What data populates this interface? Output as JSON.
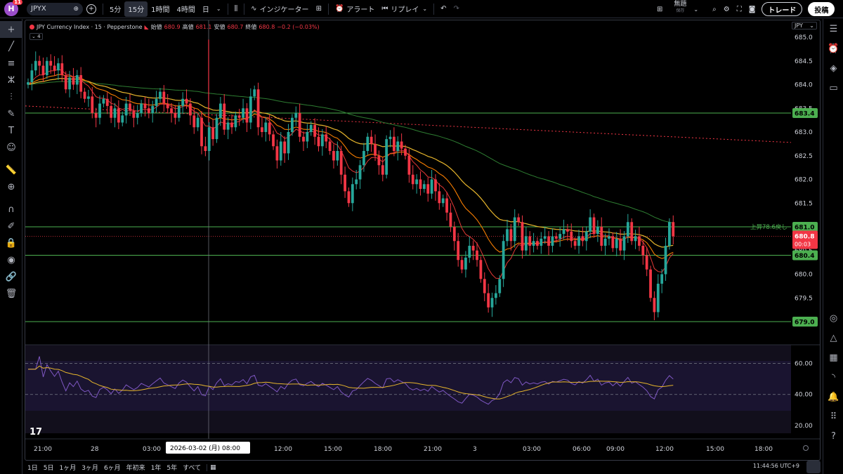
{
  "topbar": {
    "notification_count": "11",
    "logo_letter": "H",
    "symbol": "JPYX",
    "intervals": [
      "5分",
      "15分",
      "1時間",
      "4時間",
      "日"
    ],
    "selected_interval": "15分",
    "indicators_label": "インジケーター",
    "alert_label": "アラート",
    "replay_label": "リプレイ",
    "layout_name": "無題",
    "layout_sub": "保存",
    "trade_label": "トレード",
    "publish_label": "投稿"
  },
  "legend": {
    "title": "JPY Currency Index · 15 · Pepperstone",
    "open_label": "始値",
    "open": "680.9",
    "high_label": "高値",
    "high": "681.1",
    "low_label": "安値",
    "low": "680.7",
    "close_label": "終値",
    "close": "680.8",
    "change": "−0.2 (−0.03%)",
    "collapse": "4"
  },
  "currency_badge": "JPY",
  "price_axis": [
    "685.0",
    "684.5",
    "684.0",
    "683.5",
    "683.0",
    "682.5",
    "682.0",
    "681.5",
    "681.0",
    "680.5",
    "680.0",
    "679.5",
    "679.0"
  ],
  "price_levels": [
    {
      "label": "683.4",
      "value": 683.4
    },
    {
      "label": "681.0",
      "value": 681.0
    },
    {
      "label": "680.4",
      "value": 680.4
    },
    {
      "label": "679.0",
      "value": 679.0
    }
  ],
  "level_note": "上昇78.6戻し",
  "current_price": {
    "value": "680.8",
    "countdown": "00:03"
  },
  "rsi_axis": [
    "60.00",
    "40.00",
    "20.00"
  ],
  "time_axis": [
    "21:00",
    "28",
    "03:00",
    "09:00",
    "12:00",
    "15:00",
    "18:00",
    "21:00",
    "3",
    "03:00",
    "06:00",
    "09:00",
    "12:00",
    "15:00",
    "18:00"
  ],
  "crosshair_label": "2026-03-02 (月)   08:00",
  "watermark": "17",
  "bottombar": {
    "ranges": [
      "1日",
      "5日",
      "1ヶ月",
      "3ヶ月",
      "6ヶ月",
      "年初来",
      "1年",
      "5年",
      "すべて"
    ],
    "clock": "11:44:56 UTC+9"
  },
  "colors": {
    "up": "#26a69a",
    "down": "#f23645",
    "level_line": "#4caf50",
    "ma_red": "#e53935",
    "ma_orange": "#f57c00",
    "ma_yellow": "#e6b52c",
    "ma_green": "#2e7d32",
    "rsi": "#7e57c2",
    "rsi_ma": "#e6b52c"
  },
  "chart_data": {
    "type": "candlestick",
    "symbol": "JPY Currency Index",
    "ylim": [
      678.8,
      685.2
    ],
    "rsi_ylim": [
      15,
      72
    ],
    "closes": [
      684.05,
      684.3,
      684.5,
      684.4,
      684.2,
      684.5,
      684.4,
      684.3,
      684.45,
      684.2,
      683.9,
      684.15,
      684.0,
      684.2,
      683.85,
      683.7,
      683.75,
      683.4,
      683.3,
      683.6,
      683.7,
      683.55,
      683.3,
      683.5,
      683.2,
      683.35,
      683.6,
      683.45,
      683.3,
      683.4,
      683.6,
      683.5,
      683.4,
      683.55,
      683.7,
      683.85,
      683.6,
      683.5,
      683.4,
      683.3,
      683.55,
      683.7,
      683.6,
      683.35,
      683.1,
      683.3,
      682.7,
      682.6,
      683.1,
      682.85,
      683.3,
      683.6,
      683.05,
      683.2,
      683.1,
      683.35,
      683.3,
      683.5,
      683.2,
      683.75,
      683.9,
      683.1,
      683.0,
      683.2,
      682.95,
      682.7,
      682.4,
      682.8,
      682.55,
      683.0,
      683.3,
      683.4,
      682.9,
      682.8,
      683.0,
      683.15,
      682.9,
      682.7,
      682.95,
      682.8,
      682.6,
      682.4,
      682.6,
      682.1,
      681.75,
      681.5,
      681.9,
      682.0,
      682.3,
      682.6,
      682.9,
      682.75,
      682.5,
      682.3,
      682.1,
      682.85,
      682.9,
      682.6,
      682.8,
      682.65,
      682.5,
      682.1,
      681.9,
      682.0,
      681.8,
      681.9,
      681.7,
      682.0,
      681.75,
      681.5,
      681.6,
      681.3,
      681.0,
      680.7,
      680.3,
      680.1,
      680.35,
      680.6,
      680.5,
      680.3,
      679.9,
      679.6,
      679.3,
      679.5,
      679.6,
      679.9,
      680.7,
      680.95,
      680.7,
      681.2,
      681.1,
      680.5,
      680.8,
      680.6,
      680.7,
      680.6,
      680.75,
      680.8,
      680.6,
      680.8,
      680.75,
      680.85,
      680.95,
      680.9,
      680.7,
      680.6,
      680.8,
      680.7,
      680.9,
      681.2,
      680.85,
      681.0,
      680.6,
      680.75,
      680.8,
      680.55,
      680.75,
      680.5,
      680.8,
      681.1,
      680.7,
      680.8,
      680.6,
      680.4,
      680.1,
      679.5,
      679.2,
      679.8,
      680.0,
      680.6,
      681.1,
      680.8
    ],
    "overlays": [
      {
        "name": "",
        "color": "#e53935",
        "role": "fast moving average"
      },
      {
        "name": "",
        "color": "#f57c00",
        "role": "moving average"
      },
      {
        "name": "",
        "color": "#e6b52c",
        "role": "moving average"
      },
      {
        "name": "",
        "color": "#2e7d32",
        "role": "slow moving average"
      },
      {
        "name": "",
        "color": "#f23645",
        "role": "dotted trend line"
      }
    ],
    "rsi_levels": [
      60,
      40
    ]
  }
}
